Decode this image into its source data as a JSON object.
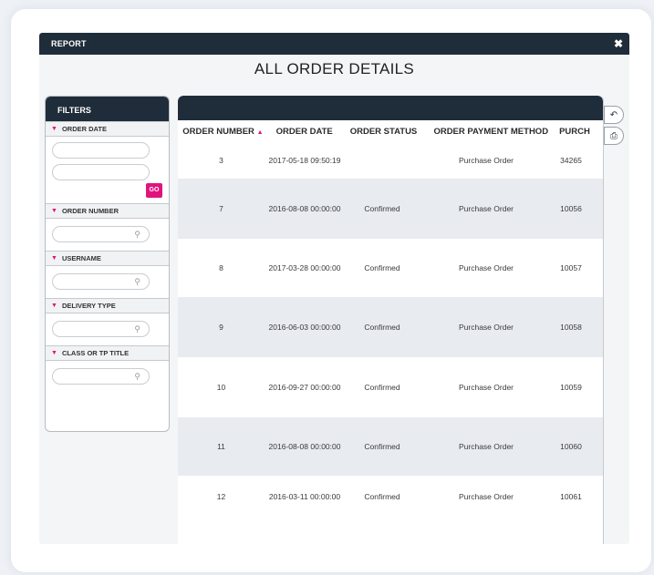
{
  "window": {
    "title": "REPORT",
    "close_label": "✖"
  },
  "page_title": "ALL ORDER DETAILS",
  "filters": {
    "header": "FILTERS",
    "sections": [
      {
        "label": "ORDER DATE"
      },
      {
        "label": "ORDER NUMBER"
      },
      {
        "label": "USERNAME"
      },
      {
        "label": "DELIVERY TYPE"
      },
      {
        "label": "CLASS OR TP TITLE"
      }
    ],
    "go_label": "GO"
  },
  "table": {
    "columns": [
      "ORDER NUMBER",
      "ORDER DATE",
      "ORDER STATUS",
      "ORDER PAYMENT METHOD",
      "PURCH"
    ],
    "sort_indicator": "▲",
    "rows": [
      {
        "order_number": "3",
        "order_date": "2017-05-18 09:50:19",
        "status": "",
        "payment": "Purchase Order",
        "purch": "34265"
      },
      {
        "order_number": "7",
        "order_date": "2016-08-08 00:00:00",
        "status": "Confirmed",
        "payment": "Purchase Order",
        "purch": "10056"
      },
      {
        "order_number": "8",
        "order_date": "2017-03-28 00:00:00",
        "status": "Confirmed",
        "payment": "Purchase Order",
        "purch": "10057"
      },
      {
        "order_number": "9",
        "order_date": "2016-06-03 00:00:00",
        "status": "Confirmed",
        "payment": "Purchase Order",
        "purch": "10058"
      },
      {
        "order_number": "10",
        "order_date": "2016-09-27 00:00:00",
        "status": "Confirmed",
        "payment": "Purchase Order",
        "purch": "10059"
      },
      {
        "order_number": "11",
        "order_date": "2016-08-08 00:00:00",
        "status": "Confirmed",
        "payment": "Purchase Order",
        "purch": "10060"
      },
      {
        "order_number": "12",
        "order_date": "2016-03-11 00:00:00",
        "status": "Confirmed",
        "payment": "Purchase Order",
        "purch": "10061"
      }
    ]
  },
  "side_buttons": [
    {
      "icon": "back-arrow-icon",
      "glyph": "↶"
    },
    {
      "icon": "print-icon",
      "glyph": "⎙"
    }
  ],
  "colors": {
    "dark_navy": "#1f2d3a",
    "accent_pink": "#e0147c",
    "row_alt": "#e8ebf0"
  }
}
